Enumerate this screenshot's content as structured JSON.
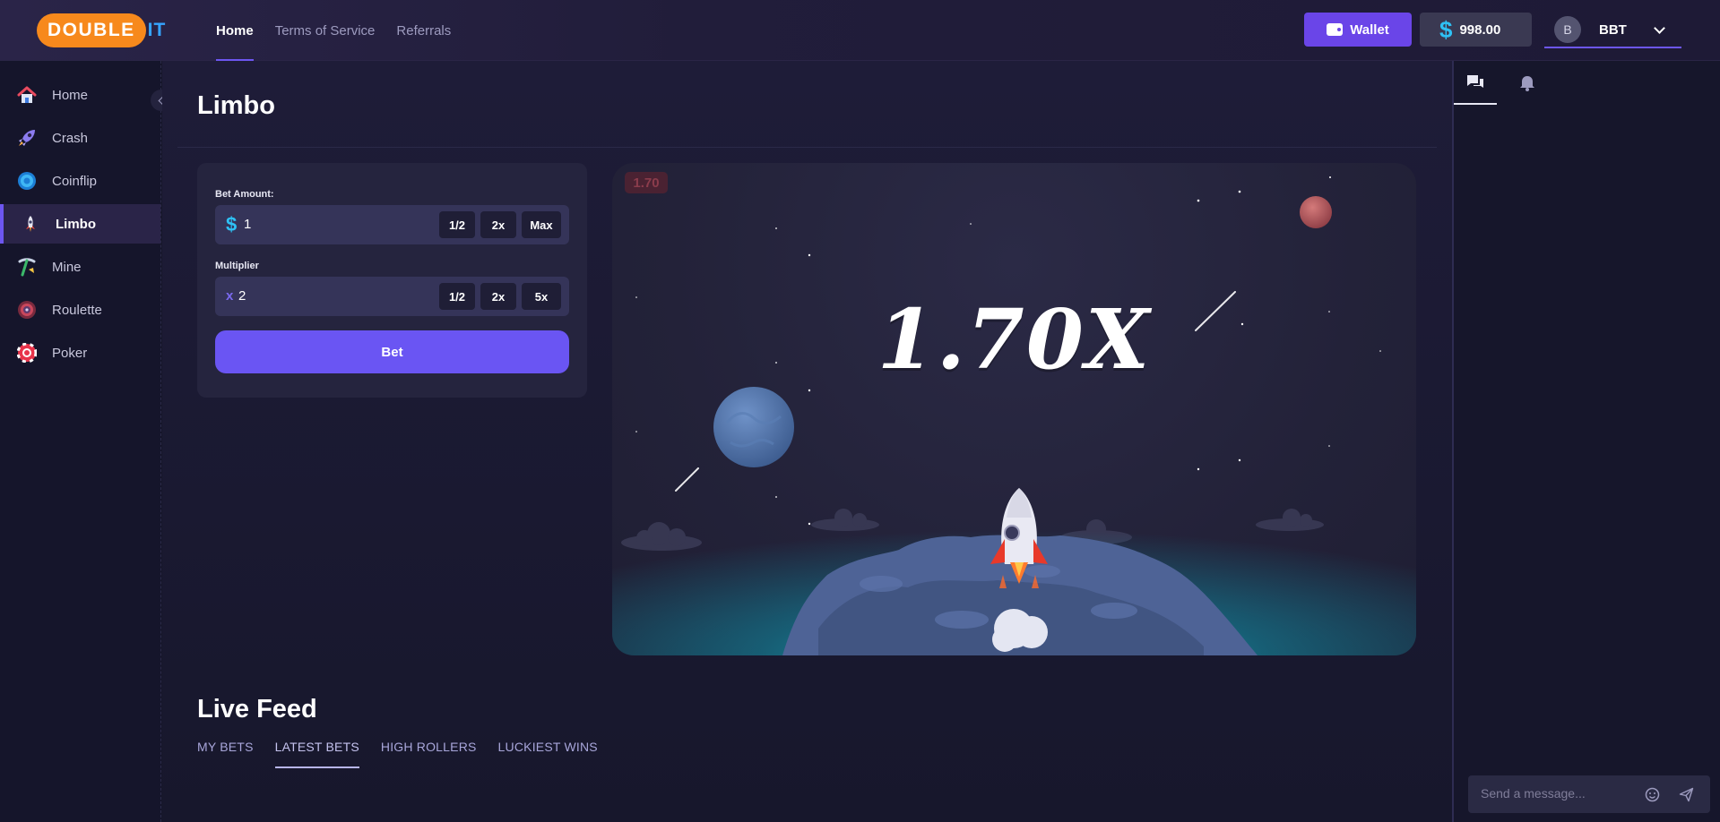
{
  "brand": {
    "logo_main": "DOUBLE",
    "logo_accent": "IT"
  },
  "topnav": [
    {
      "label": "Home",
      "active": true
    },
    {
      "label": "Terms of Service",
      "active": false
    },
    {
      "label": "Referrals",
      "active": false
    }
  ],
  "header": {
    "wallet_label": "Wallet",
    "currency_symbol": "$",
    "balance": "998.00",
    "avatar_initial": "B",
    "username": "BBT"
  },
  "sidebar": {
    "items": [
      {
        "label": "Home",
        "icon": "house-icon"
      },
      {
        "label": "Crash",
        "icon": "rocket-icon"
      },
      {
        "label": "Coinflip",
        "icon": "coin-icon"
      },
      {
        "label": "Limbo",
        "icon": "limbo-rocket-icon",
        "active": true
      },
      {
        "label": "Mine",
        "icon": "pickaxe-icon"
      },
      {
        "label": "Roulette",
        "icon": "roulette-icon"
      },
      {
        "label": "Poker",
        "icon": "poker-chip-icon"
      }
    ]
  },
  "page": {
    "title": "Limbo"
  },
  "bet_form": {
    "amount_label": "Bet Amount:",
    "amount_prefix": "$",
    "amount_value": "1",
    "amount_buttons": [
      "1/2",
      "2x",
      "Max"
    ],
    "multiplier_label": "Multiplier",
    "multiplier_prefix": "x",
    "multiplier_value": "2",
    "multiplier_buttons": [
      "1/2",
      "2x",
      "5x"
    ],
    "bet_button": "Bet"
  },
  "game": {
    "last_result": "1.70",
    "current_multiplier": "1.70X"
  },
  "live_feed": {
    "title": "Live Feed",
    "tabs": [
      {
        "label": "MY BETS",
        "active": false
      },
      {
        "label": "LATEST BETS",
        "active": true
      },
      {
        "label": "HIGH ROLLERS",
        "active": false
      },
      {
        "label": "LUCKIEST WINS",
        "active": false
      }
    ]
  },
  "chat": {
    "tabs": [
      {
        "icon": "chat-icon",
        "active": true
      },
      {
        "icon": "bell-icon",
        "active": false
      }
    ],
    "message_placeholder": "Send a message..."
  },
  "colors": {
    "accent": "#6a55f3",
    "brand_orange": "#f7891c",
    "currency_cyan": "#2ec1f5",
    "background": "#16162a"
  }
}
